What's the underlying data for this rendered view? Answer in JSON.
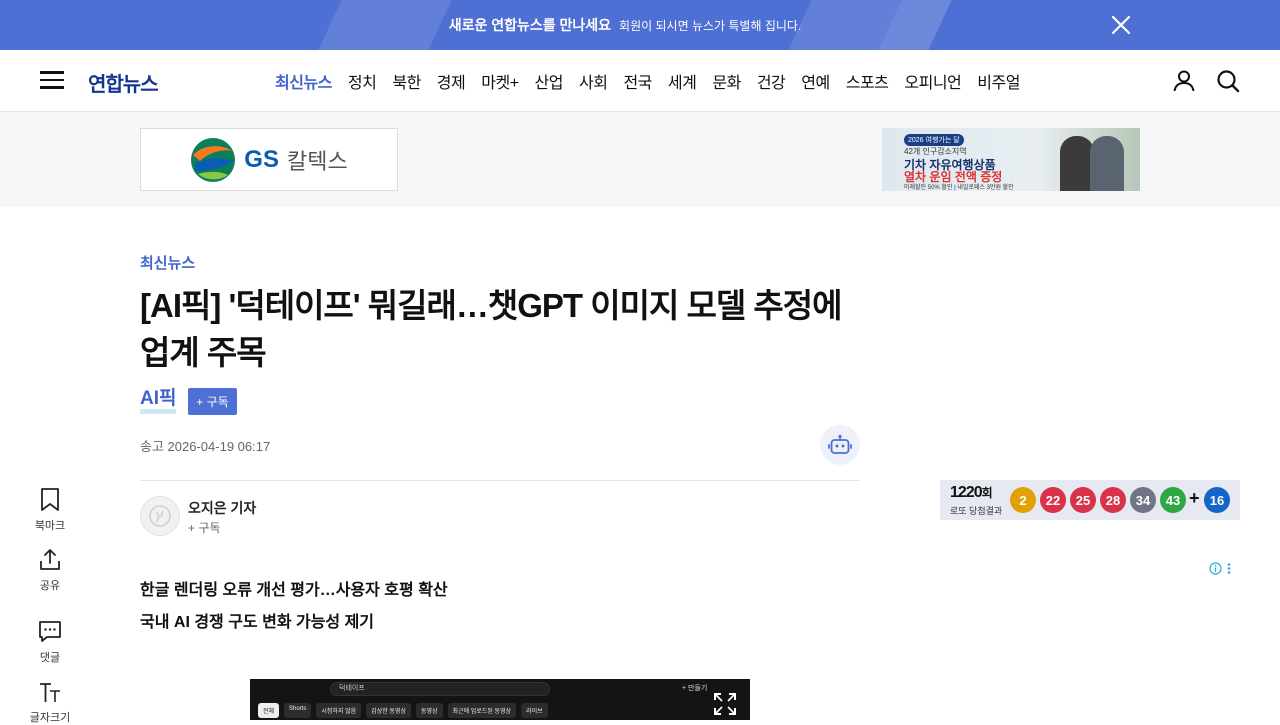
{
  "promo": {
    "headline": "새로운 연합뉴스를 만나세요",
    "sub": "회원이 되시면 뉴스가 특별해 집니다."
  },
  "header": {
    "logo": "연합뉴스",
    "nav": [
      "최신뉴스",
      "정치",
      "북한",
      "경제",
      "마켓+",
      "산업",
      "사회",
      "전국",
      "세계",
      "문화",
      "건강",
      "연예",
      "스포츠",
      "오피니언",
      "비주얼"
    ],
    "active_nav": "최신뉴스"
  },
  "ads": {
    "left": {
      "brand": "GS",
      "name": "칼텍스"
    },
    "right": {
      "tag": "2026 여행가는 달",
      "line1": "42개 인구감소지역",
      "line2": "기차 자유여행상품",
      "line3": "열차 운임 전액 증정",
      "line4": "미래할인 50% 할인 | 내일로패스 3만원 할인"
    }
  },
  "article": {
    "section": "최신뉴스",
    "headline": "[AI픽] '덕테이프' 뭐길래…챗GPT 이미지 모델 추정에 업계 주목",
    "series": "AI픽",
    "subscribe_label": "+ 구독",
    "published_label": "송고",
    "published": "2026-04-19 06:17",
    "reporter": {
      "name": "오지은 기자",
      "subscribe": "+ 구독"
    },
    "summary": [
      "한글 렌더링 오류 개선 평가…사용자 호평 확산",
      "국내 AI 경쟁 구도 변화 가능성 제기"
    ]
  },
  "tools": {
    "bookmark": "북마크",
    "share": "공유",
    "comment": "댓글",
    "font_size": "글자크기"
  },
  "lotto": {
    "round_num": "1220",
    "round_suffix": "회",
    "caption": "로또 당첨결과",
    "balls": [
      {
        "n": "2",
        "color": "#e3a006"
      },
      {
        "n": "22",
        "color": "#d8334a"
      },
      {
        "n": "25",
        "color": "#d8334a"
      },
      {
        "n": "28",
        "color": "#d8334a"
      },
      {
        "n": "34",
        "color": "#6f7585"
      },
      {
        "n": "43",
        "color": "#2ea845"
      }
    ],
    "plus": "+",
    "bonus": {
      "n": "16",
      "color": "#1565c8"
    }
  },
  "video": {
    "search_text": "덕테이프",
    "make_label": "+ 만들기",
    "chips": [
      "전체",
      "Shorts",
      "시청하지 않음",
      "감상한 동영상",
      "동영상",
      "최근에 업로드된 동영상",
      "라이브"
    ]
  },
  "colors": {
    "brand_blue": "#4e6fd3",
    "accent_text": "#4063cf",
    "logo_navy": "#14358f"
  }
}
